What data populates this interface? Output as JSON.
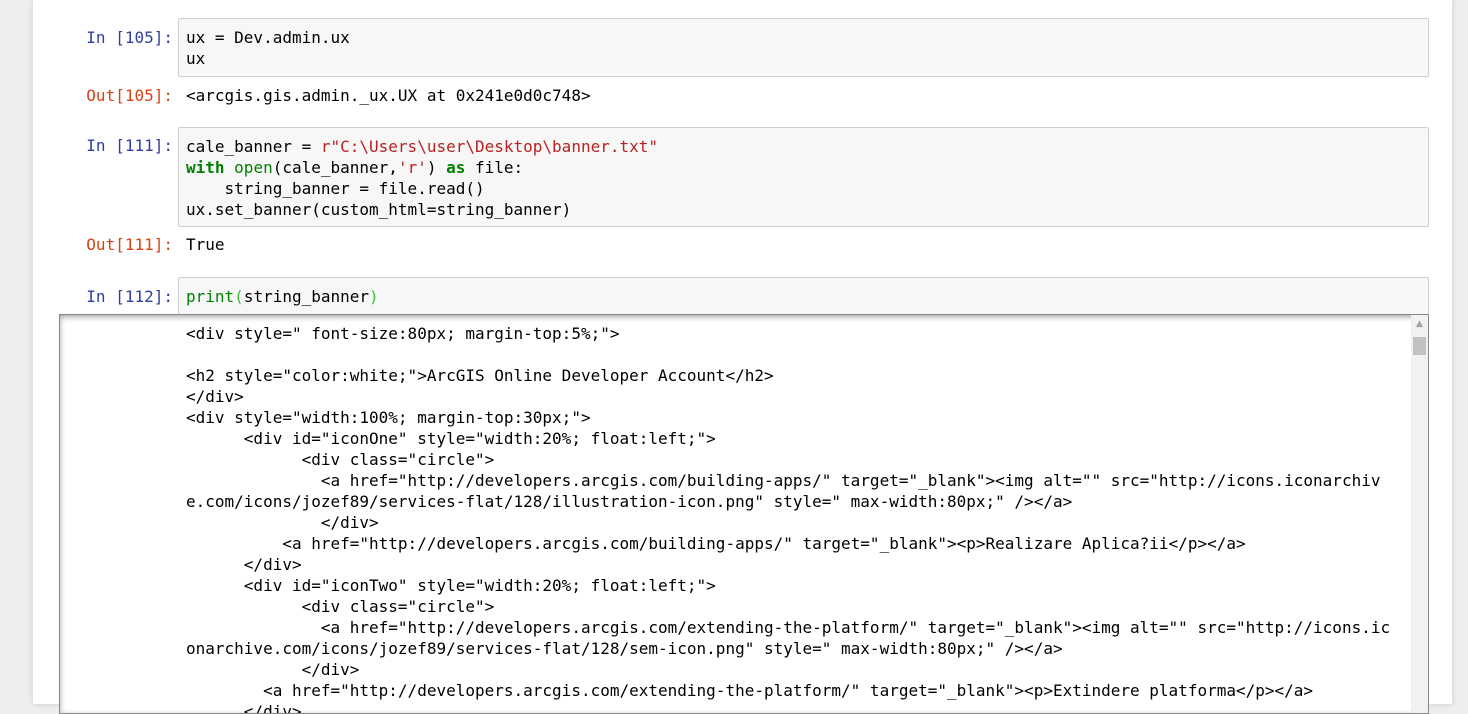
{
  "cells": [
    {
      "in_prompt": "In [105]:",
      "code_lines": [
        "ux = Dev.admin.ux",
        "ux"
      ],
      "out_prompt": "Out[105]:",
      "output": "<arcgis.gis.admin._ux.UX at 0x241e0d0c748>"
    },
    {
      "in_prompt": "In [111]:",
      "code": {
        "l1_var": "cale_banner = ",
        "l1_str": "r\"C:\\Users\\user\\Desktop\\banner.txt\"",
        "l2_kw": "with",
        "l2_open": "open",
        "l2_args_a": "(cale_banner,",
        "l2_str": "'r'",
        "l2_args_b": ") ",
        "l2_as": "as",
        "l2_rest": " file:",
        "l3": "    string_banner = file.read()",
        "l4": "ux.set_banner(custom_html=string_banner)"
      },
      "out_prompt": "Out[111]:",
      "output": "True"
    },
    {
      "in_prompt": "In [112]:",
      "code": {
        "fn": "print",
        "open_paren": "(",
        "arg": "string_banner",
        "close_paren": ")"
      },
      "output_lines": [
        "<div style=\" font-size:80px; margin-top:5%;\">",
        "",
        "<h2 style=\"color:white;\">ArcGIS Online Developer Account</h2>",
        "</div>",
        "<div style=\"width:100%; margin-top:30px;\">",
        "      <div id=\"iconOne\" style=\"width:20%; float:left;\">",
        "            <div class=\"circle\">",
        "              <a href=\"http://developers.arcgis.com/building-apps/\" target=\"_blank\"><img alt=\"\" src=\"http://icons.iconarchiv",
        "e.com/icons/jozef89/services-flat/128/illustration-icon.png\" style=\" max-width:80px;\" /></a>",
        "              </div>",
        "          <a href=\"http://developers.arcgis.com/building-apps/\" target=\"_blank\"><p>Realizare Aplica?ii</p></a>",
        "      </div>",
        "      <div id=\"iconTwo\" style=\"width:20%; float:left;\">",
        "            <div class=\"circle\">",
        "              <a href=\"http://developers.arcgis.com/extending-the-platform/\" target=\"_blank\"><img alt=\"\" src=\"http://icons.ic",
        "onarchive.com/icons/jozef89/services-flat/128/sem-icon.png\" style=\" max-width:80px;\" /></a>",
        "            </div>",
        "        <a href=\"http://developers.arcgis.com/extending-the-platform/\" target=\"_blank\"><p>Extindere platforma</p></a>",
        "      </div>"
      ]
    }
  ],
  "icons": {
    "scroll_up": "scroll-up-arrow-icon"
  },
  "colors": {
    "in_prompt": "#303f9f",
    "out_prompt": "#d84315",
    "keyword": "#008000",
    "string": "#ba2121"
  }
}
